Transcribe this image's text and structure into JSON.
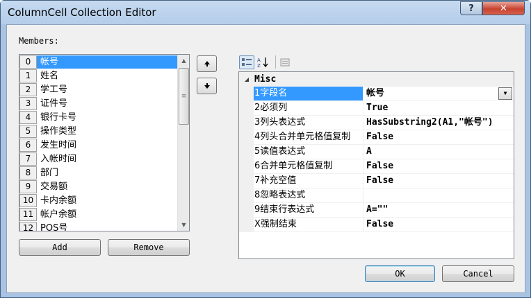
{
  "window": {
    "title": "ColumnCell Collection Editor",
    "help_label": "?",
    "close_label": "✕"
  },
  "members": {
    "label": "Members:",
    "items": [
      {
        "index": "0",
        "name": "帐号"
      },
      {
        "index": "1",
        "name": "姓名"
      },
      {
        "index": "2",
        "name": "学工号"
      },
      {
        "index": "3",
        "name": "证件号"
      },
      {
        "index": "4",
        "name": "银行卡号"
      },
      {
        "index": "5",
        "name": "操作类型"
      },
      {
        "index": "6",
        "name": "发生时间"
      },
      {
        "index": "7",
        "name": "入帐时间"
      },
      {
        "index": "8",
        "name": "部门"
      },
      {
        "index": "9",
        "name": "交易额"
      },
      {
        "index": "10",
        "name": "卡内余额"
      },
      {
        "index": "11",
        "name": "帐户余额"
      },
      {
        "index": "12",
        "name": "POS号"
      }
    ],
    "selected_index": 0
  },
  "buttons": {
    "add": "Add",
    "remove": "Remove",
    "ok": "OK",
    "cancel": "Cancel",
    "move_up_icon": "arrow-up",
    "move_down_icon": "arrow-down"
  },
  "property_grid": {
    "category": "Misc",
    "rows": [
      {
        "name": "1字段名",
        "value": "帐号"
      },
      {
        "name": "2必须列",
        "value": "True"
      },
      {
        "name": "3列头表达式",
        "value": "HasSubstring2(A1,\"帐号\")"
      },
      {
        "name": "4列头合并单元格值复制",
        "value": "False"
      },
      {
        "name": "5读值表达式",
        "value": "A"
      },
      {
        "name": "6合并单元格值复制",
        "value": "False"
      },
      {
        "name": "7补充空值",
        "value": "False"
      },
      {
        "name": "8忽略表达式",
        "value": ""
      },
      {
        "name": "9结束行表达式",
        "value": "A=\"\""
      },
      {
        "name": "X强制结束",
        "value": "False"
      }
    ],
    "selected_row": 0
  },
  "colors": {
    "selection": "#3399ff",
    "titlebar": "#b9d1ea",
    "close_button": "#c64330"
  }
}
